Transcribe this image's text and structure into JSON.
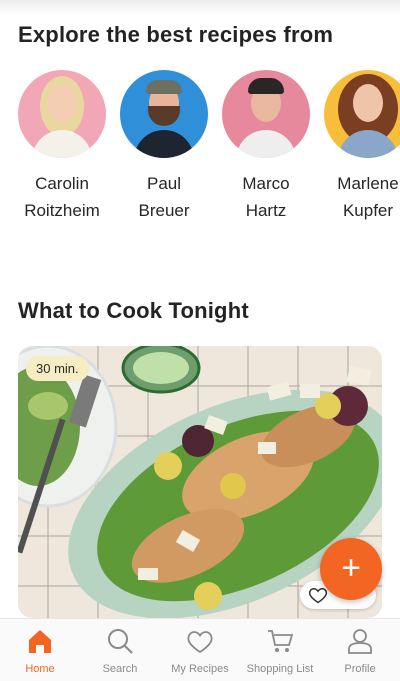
{
  "sections": {
    "creators_title": "Explore the best recipes from",
    "cook_title": "What to Cook Tonight"
  },
  "creators": [
    {
      "first": "Carolin",
      "last": "Roitzheim",
      "bg": "#f2a7b6"
    },
    {
      "first": "Paul",
      "last": "Breuer",
      "bg": "#2f8fd8"
    },
    {
      "first": "Marco",
      "last": "Hartz",
      "bg": "#e6899c"
    },
    {
      "first": "Marlene",
      "last": "Kupfer",
      "bg": "#f7be3a"
    }
  ],
  "recipe_card": {
    "time_badge": "30 min.",
    "favorite_icon": "heart-icon"
  },
  "fab": {
    "label": "+",
    "color": "#f26522"
  },
  "nav": {
    "items": [
      {
        "label": "Home",
        "icon": "home-icon",
        "active": true
      },
      {
        "label": "Search",
        "icon": "search-icon",
        "active": false
      },
      {
        "label": "My Recipes",
        "icon": "heart-icon",
        "active": false
      },
      {
        "label": "Shopping List",
        "icon": "cart-icon",
        "active": false
      },
      {
        "label": "Profile",
        "icon": "profile-icon",
        "active": false
      }
    ]
  },
  "colors": {
    "accent": "#f26522",
    "badge_bg": "#f6edc5"
  }
}
